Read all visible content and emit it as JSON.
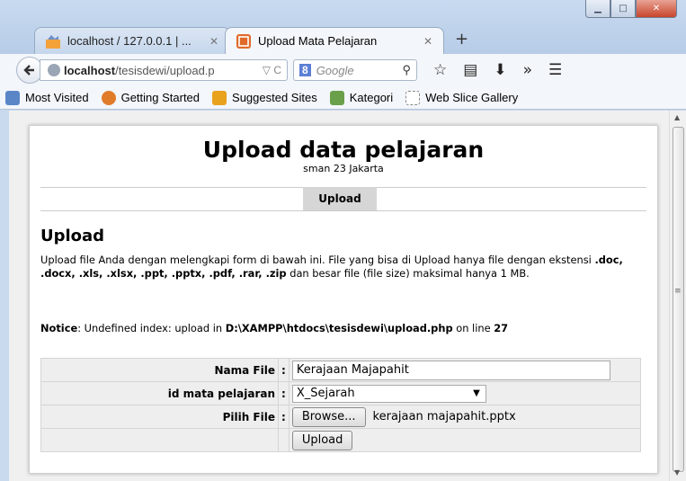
{
  "browser": {
    "window_buttons": {
      "minimize": "▁",
      "maximize": "□",
      "close": "✕"
    },
    "tabs": [
      {
        "label": "localhost / 127.0.0.1 | ...",
        "close": "✕",
        "active": false
      },
      {
        "label": "Upload Mata Pelajaran",
        "close": "✕",
        "active": true
      }
    ],
    "new_tab": "+",
    "url": {
      "host": "localhost",
      "path": "/tesisdewi/upload.p"
    },
    "url_controls": "▽ C",
    "search": {
      "engine": "8",
      "placeholder": "Google"
    },
    "bookmarks": [
      {
        "label": "Most Visited",
        "icon": "#5a86c8"
      },
      {
        "label": "Getting Started",
        "icon": "#e07b2a"
      },
      {
        "label": "Suggested Sites",
        "icon": "#e8a21c"
      },
      {
        "label": "Kategori",
        "icon": "#6aa04a"
      },
      {
        "label": "Web Slice Gallery",
        "icon": "#dddddd"
      }
    ]
  },
  "page": {
    "title": "Upload data pelajaran",
    "subtitle": "sman 23 Jakarta",
    "menu_item": "Upload",
    "heading": "Upload",
    "description_parts": {
      "a": "Upload file Anda dengan melengkapi form di bawah ini. File yang bisa di Upload hanya file dengan ekstensi ",
      "exts": ".doc, .docx, .xls, .xlsx, .ppt, .pptx, .pdf, .rar, .zip",
      "b": " dan besar file (file size) maksimal hanya 1 MB."
    },
    "notice": {
      "label": "Notice",
      "text_a": ": Undefined index: upload in ",
      "path": "D:\\XAMPP\\htdocs\\tesisdewi\\upload.php",
      "text_b": " on line ",
      "line": "27"
    },
    "form": {
      "nama_file_label": "Nama File",
      "nama_file_value": "Kerajaan Majapahit",
      "mapel_label": "id mata pelajaran",
      "mapel_value": "X_Sejarah",
      "pilih_label": "Pilih File",
      "browse_label": "Browse...",
      "file_name": "kerajaan majapahit.pptx",
      "submit_label": "Upload",
      "sep": ":"
    }
  }
}
